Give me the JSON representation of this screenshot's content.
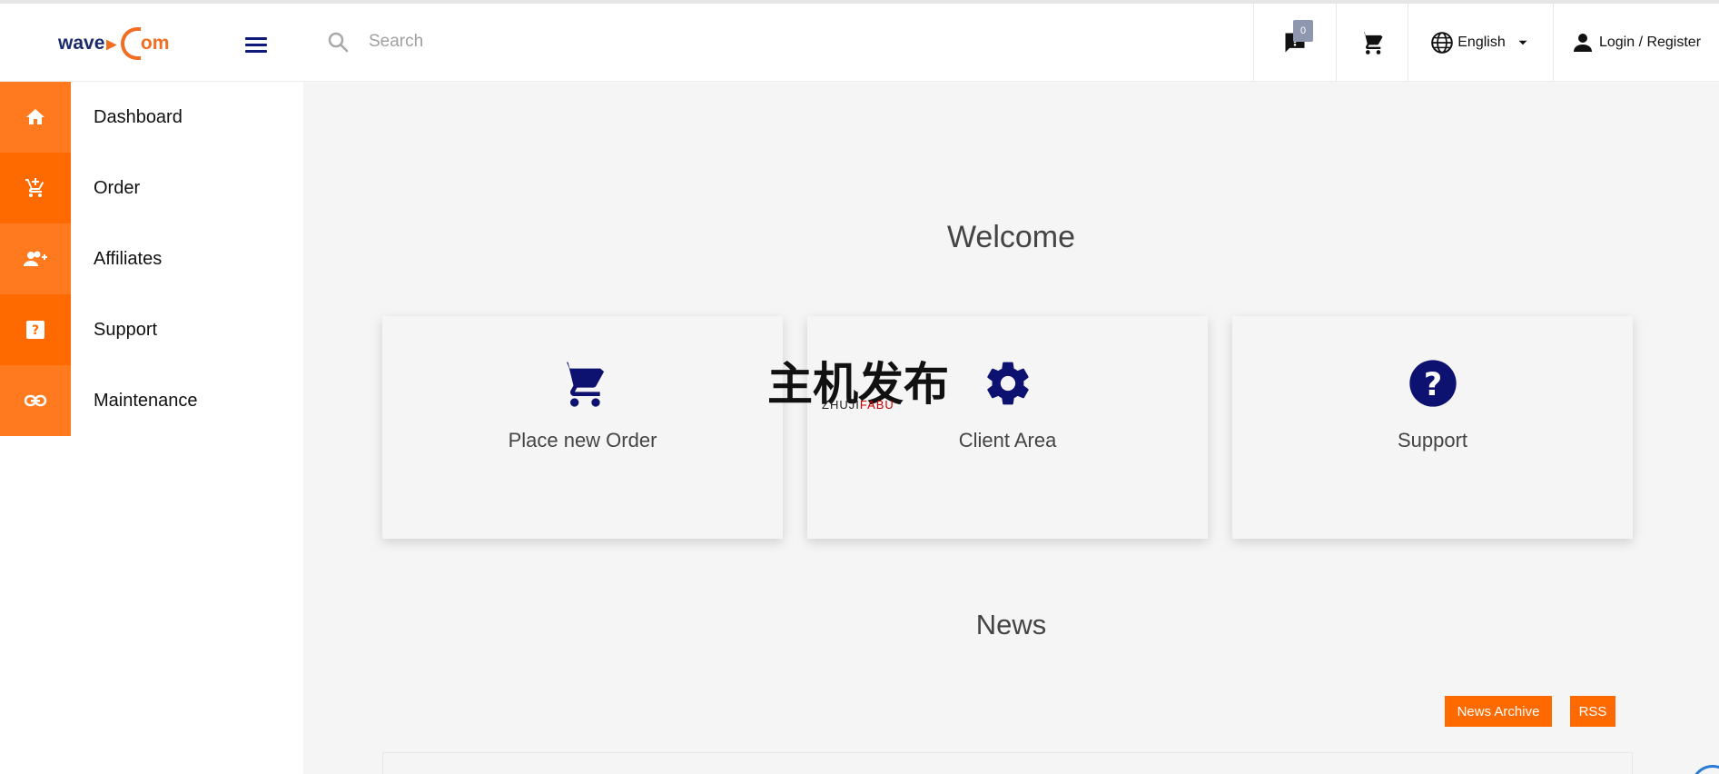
{
  "header": {
    "logo_text_left": "wave",
    "logo_text_right": "om",
    "search_placeholder": "Search",
    "notification_count": "0",
    "language": "English",
    "login_label": "Login / Register"
  },
  "sidebar": {
    "items": [
      {
        "label": "Dashboard",
        "icon": "home-icon"
      },
      {
        "label": "Order",
        "icon": "add-cart-icon"
      },
      {
        "label": "Affiliates",
        "icon": "add-user-icon"
      },
      {
        "label": "Support",
        "icon": "question-box-icon"
      },
      {
        "label": "Maintenance",
        "icon": "link-icon"
      }
    ]
  },
  "main": {
    "welcome_title": "Welcome",
    "cards": [
      {
        "label": "Place new Order",
        "icon": "cart-icon"
      },
      {
        "label": "Client Area",
        "icon": "gear-icon"
      },
      {
        "label": "Support",
        "icon": "help-circle-icon"
      }
    ],
    "news_title": "News",
    "news_archive_label": "News Archive",
    "rss_label": "RSS"
  },
  "watermark": {
    "cn_text": "主机发布",
    "en_text_a": "ZHUJI",
    "en_text_b": "FABU"
  },
  "colors": {
    "accent_orange": "#ff6a00",
    "icon_navy": "#0d1270"
  }
}
